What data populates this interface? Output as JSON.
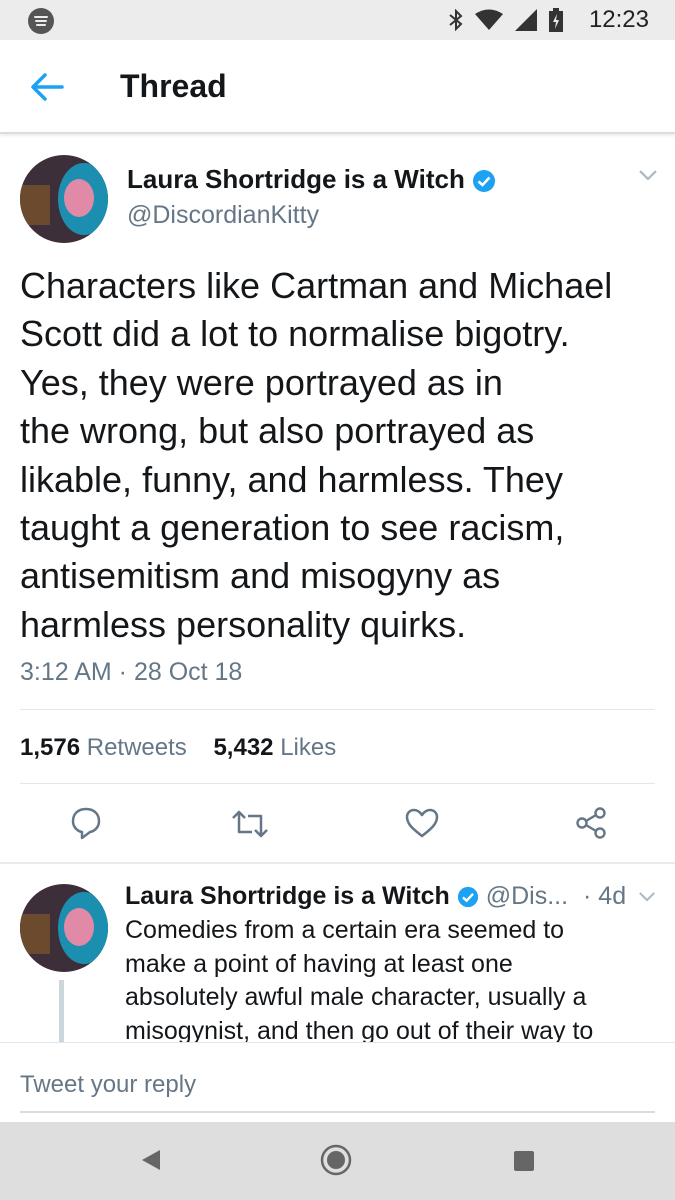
{
  "status_bar": {
    "time": "12:23"
  },
  "header": {
    "title": "Thread"
  },
  "tweet": {
    "author_name": "Laura Shortridge is a Witch",
    "author_handle": "@DiscordianKitty",
    "text_lines": [
      "Characters like Cartman and Michael",
      "Scott did a lot to normalise bigotry.",
      "Yes, they were portrayed as in",
      "the wrong, but also portrayed as",
      "likable, funny, and harmless. They",
      "taught a generation to see racism,",
      "antisemitism and misogyny as",
      "harmless personality quirks."
    ],
    "timestamp": "3:12 AM · 28 Oct 18",
    "retweets_count": "1,576",
    "retweets_label": "Retweets",
    "likes_count": "5,432",
    "likes_label": "Likes"
  },
  "reply_tweet": {
    "author_name": "Laura Shortridge is a Witch",
    "author_handle": "@Dis...",
    "age": "· 4d",
    "text_lines": [
      "Comedies from a certain era seemed to",
      "make a point of having at least one",
      "absolutely awful male character, usually a",
      "misogynist, and then go out of their way to"
    ]
  },
  "reply_box": {
    "placeholder": "Tweet your reply"
  },
  "colors": {
    "accent": "#1da1f2",
    "text": "#14171a",
    "secondary": "#657786"
  },
  "icons": [
    "spotify-icon",
    "bluetooth-icon",
    "wifi-icon",
    "signal-icon",
    "battery-icon",
    "back-arrow-icon",
    "verified-icon",
    "chevron-down-icon",
    "reply-icon",
    "retweet-icon",
    "like-icon",
    "share-icon",
    "nav-back-icon",
    "nav-home-icon",
    "nav-recents-icon"
  ]
}
